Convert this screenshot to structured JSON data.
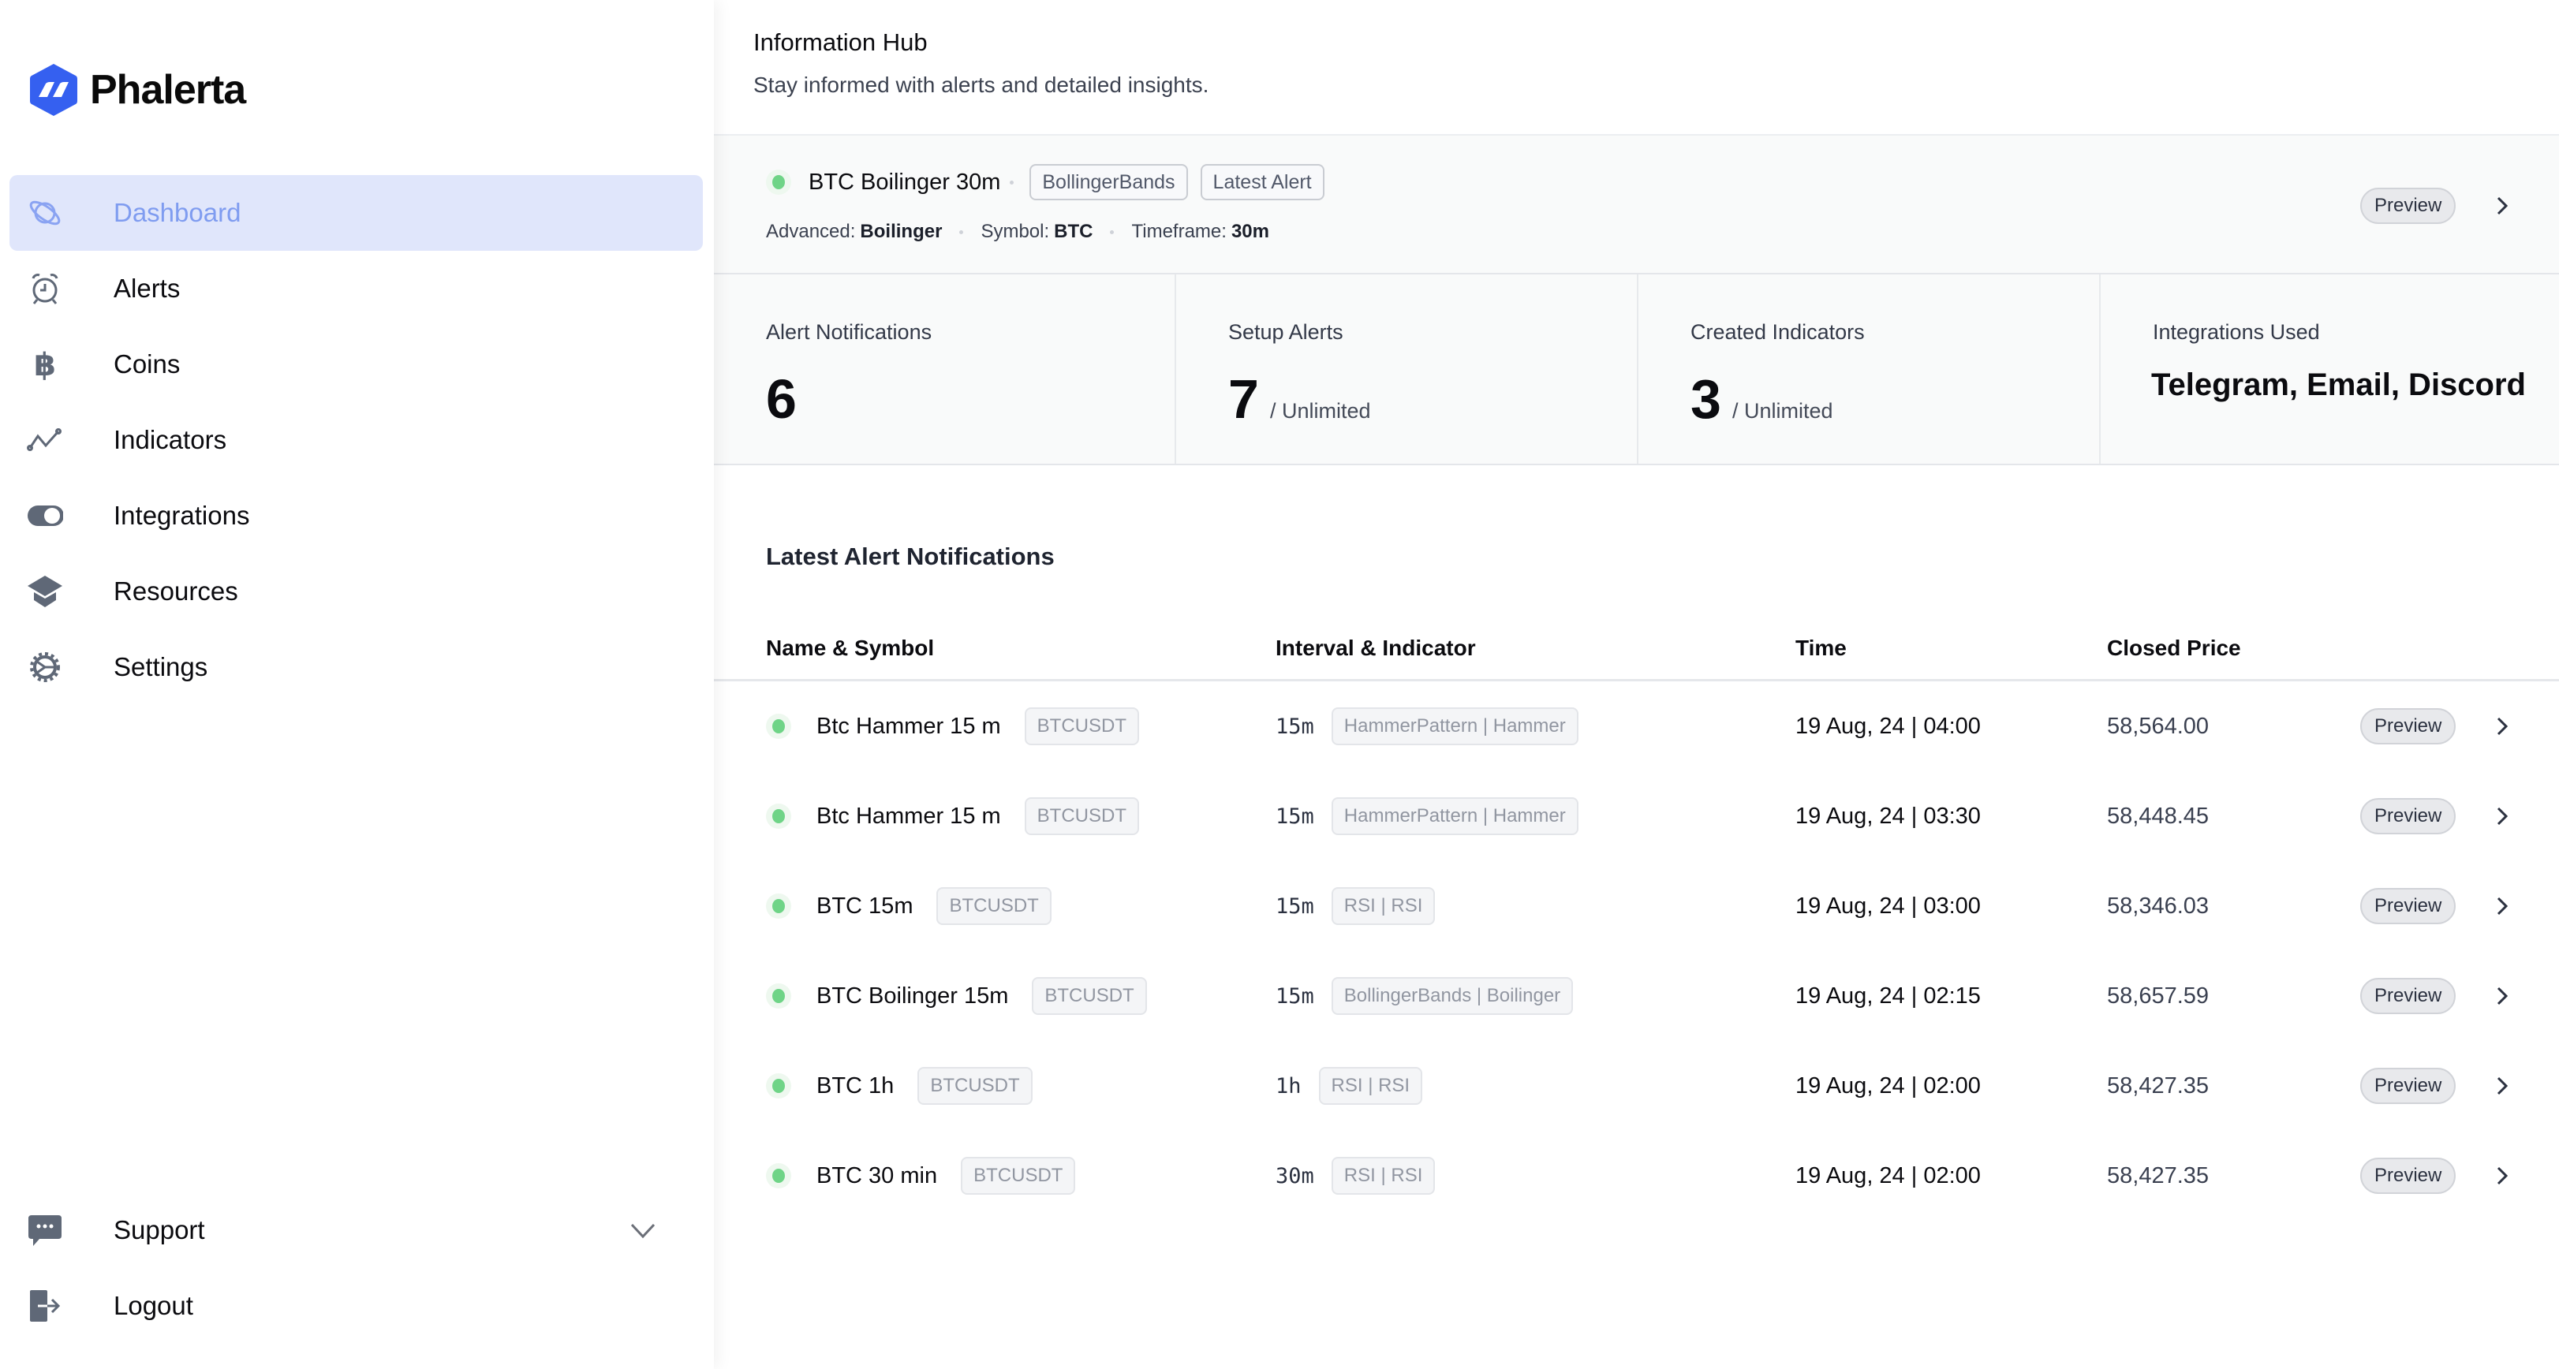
{
  "brand": {
    "name": "Phalerta",
    "accent": "#3560f0"
  },
  "sidebar": {
    "items": [
      {
        "label": "Dashboard",
        "icon": "planet-icon",
        "active": true
      },
      {
        "label": "Alerts",
        "icon": "alarm-clock-icon"
      },
      {
        "label": "Coins",
        "icon": "bitcoin-icon"
      },
      {
        "label": "Indicators",
        "icon": "line-chart-icon"
      },
      {
        "label": "Integrations",
        "icon": "toggle-icon"
      },
      {
        "label": "Resources",
        "icon": "graduation-cap-icon"
      },
      {
        "label": "Settings",
        "icon": "gear-icon"
      }
    ],
    "bottom": [
      {
        "label": "Support",
        "icon": "chat-bubble-icon"
      },
      {
        "label": "Logout",
        "icon": "logout-icon"
      }
    ]
  },
  "header": {
    "title": "Information Hub",
    "subtitle": "Stay informed with alerts and detailed insights."
  },
  "latest_alert": {
    "name": "BTC Boilinger 30m",
    "tags": [
      "BollingerBands",
      "Latest Alert"
    ],
    "advanced_label": "Advanced:",
    "advanced_value": "Boilinger",
    "symbol_label": "Symbol:",
    "symbol_value": "BTC",
    "timeframe_label": "Timeframe:",
    "timeframe_value": "30m",
    "preview_label": "Preview",
    "status_color": "#6fd487"
  },
  "stats": [
    {
      "label": "Alert Notifications",
      "value": "6",
      "suffix": ""
    },
    {
      "label": "Setup Alerts",
      "value": "7",
      "suffix": "/ Unlimited"
    },
    {
      "label": "Created Indicators",
      "value": "3",
      "suffix": "/ Unlimited"
    },
    {
      "label": "Integrations Used",
      "text": "Telegram, Email, Discord"
    }
  ],
  "table": {
    "title": "Latest Alert Notifications",
    "columns": [
      "Name & Symbol",
      "Interval & Indicator",
      "Time",
      "Closed Price"
    ],
    "preview_label": "Preview",
    "rows": [
      {
        "name": "Btc Hammer 15 m",
        "symbol": "BTCUSDT",
        "interval": "15m",
        "indicator": "HammerPattern | Hammer",
        "time": "19 Aug, 24 | 04:00",
        "price": "58,564.00"
      },
      {
        "name": "Btc Hammer 15 m",
        "symbol": "BTCUSDT",
        "interval": "15m",
        "indicator": "HammerPattern | Hammer",
        "time": "19 Aug, 24 | 03:30",
        "price": "58,448.45"
      },
      {
        "name": "BTC 15m",
        "symbol": "BTCUSDT",
        "interval": "15m",
        "indicator": "RSI | RSI",
        "time": "19 Aug, 24 | 03:00",
        "price": "58,346.03"
      },
      {
        "name": "BTC Boilinger 15m",
        "symbol": "BTCUSDT",
        "interval": "15m",
        "indicator": "BollingerBands | Boilinger",
        "time": "19 Aug, 24 | 02:15",
        "price": "58,657.59"
      },
      {
        "name": "BTC 1h",
        "symbol": "BTCUSDT",
        "interval": "1h",
        "indicator": "RSI | RSI",
        "time": "19 Aug, 24 | 02:00",
        "price": "58,427.35"
      },
      {
        "name": "BTC 30 min",
        "symbol": "BTCUSDT",
        "interval": "30m",
        "indicator": "RSI | RSI",
        "time": "19 Aug, 24 | 02:00",
        "price": "58,427.35"
      }
    ]
  }
}
